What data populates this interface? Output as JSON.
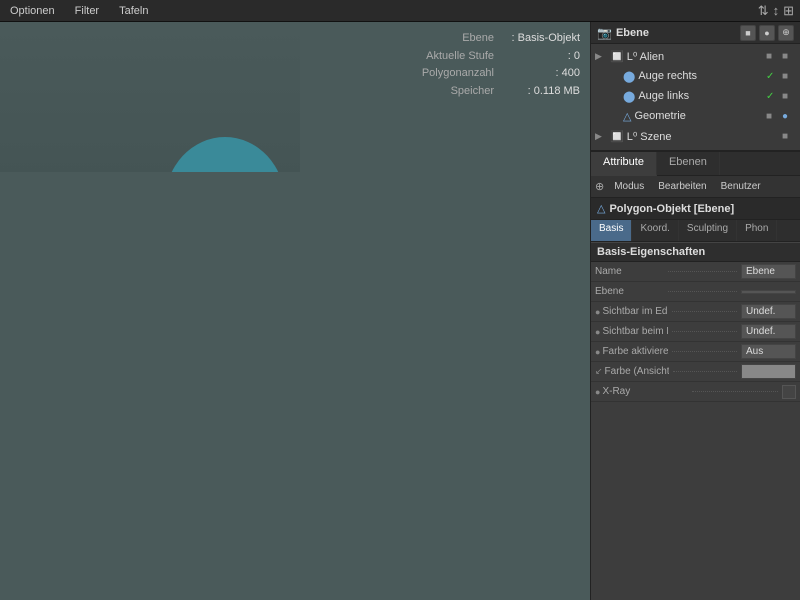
{
  "menubar": {
    "items": [
      "Optionen",
      "Filter",
      "Tafeln"
    ],
    "icons": [
      "⇅",
      "↕",
      "⊞"
    ]
  },
  "scene_panel": {
    "title": "Ebene",
    "items": [
      {
        "indent": 0,
        "expand": "▶",
        "icon": "🔲",
        "label": "Alien",
        "vis": [
          "■",
          "■"
        ]
      },
      {
        "indent": 1,
        "expand": " ",
        "icon": "👁",
        "label": "Auge rechts",
        "vis": [
          "✓",
          "■"
        ]
      },
      {
        "indent": 1,
        "expand": " ",
        "icon": "👁",
        "label": "Auge links",
        "vis": [
          "✓",
          "■"
        ]
      },
      {
        "indent": 1,
        "expand": " ",
        "icon": "△",
        "label": "Geometrie",
        "vis": [
          "■",
          "●"
        ]
      },
      {
        "indent": 0,
        "expand": "▶",
        "icon": "🔲",
        "label": "Szene",
        "vis": [
          "■"
        ]
      }
    ]
  },
  "attr_panel": {
    "tabs": [
      {
        "label": "Attribute",
        "active": true
      },
      {
        "label": "Ebenen",
        "active": false
      }
    ],
    "toolbar": {
      "icon": "⊕",
      "buttons": [
        "Modus",
        "Bearbeiten",
        "Benutzer"
      ]
    },
    "obj_header": {
      "icon": "△",
      "title": "Polygon-Objekt [Ebene]"
    },
    "prop_tabs": [
      {
        "label": "Basis",
        "active": true
      },
      {
        "label": "Koord.",
        "active": false
      },
      {
        "label": "Sculpting",
        "active": false
      },
      {
        "label": "Phon",
        "active": false
      }
    ],
    "section": "Basis-Eigenschaften",
    "properties": [
      {
        "label": "Name",
        "dots": true,
        "value": "Ebene",
        "type": "text",
        "indicator": "none"
      },
      {
        "label": "Ebene",
        "dots": true,
        "value": "",
        "type": "text",
        "indicator": "none"
      },
      {
        "label": "Sichtbar im Editor",
        "dots": true,
        "value": "Undef.",
        "type": "text",
        "indicator": "circle"
      },
      {
        "label": "Sichtbar beim Rendern",
        "dots": true,
        "value": "Undef.",
        "type": "text",
        "indicator": "circle"
      },
      {
        "label": "Farbe aktivieren",
        "dots": true,
        "value": "Aus",
        "type": "text",
        "indicator": "circle"
      },
      {
        "label": "Farbe (Ansicht)",
        "dots": true,
        "value": "",
        "type": "color",
        "indicator": "arrow"
      },
      {
        "label": "X-Ray",
        "dots": true,
        "value": "",
        "type": "checkbox",
        "indicator": "circle"
      }
    ]
  },
  "info_overlay": {
    "rows": [
      {
        "label": "Ebene",
        "value": ": Basis-Objekt"
      },
      {
        "label": "Aktuelle Stufe",
        "value": ": 0"
      },
      {
        "label": "Polygonanzahl",
        "value": ": 400"
      },
      {
        "label": "Speicher",
        "value": ": 0.118 MB"
      }
    ]
  },
  "colors": {
    "teal": "#4a9aaa",
    "orange_selection": "#ff8800",
    "grid": "#4a5555",
    "axis_x": "#cc2222",
    "axis_y": "#22cc22",
    "axis_z": "#2222cc"
  }
}
